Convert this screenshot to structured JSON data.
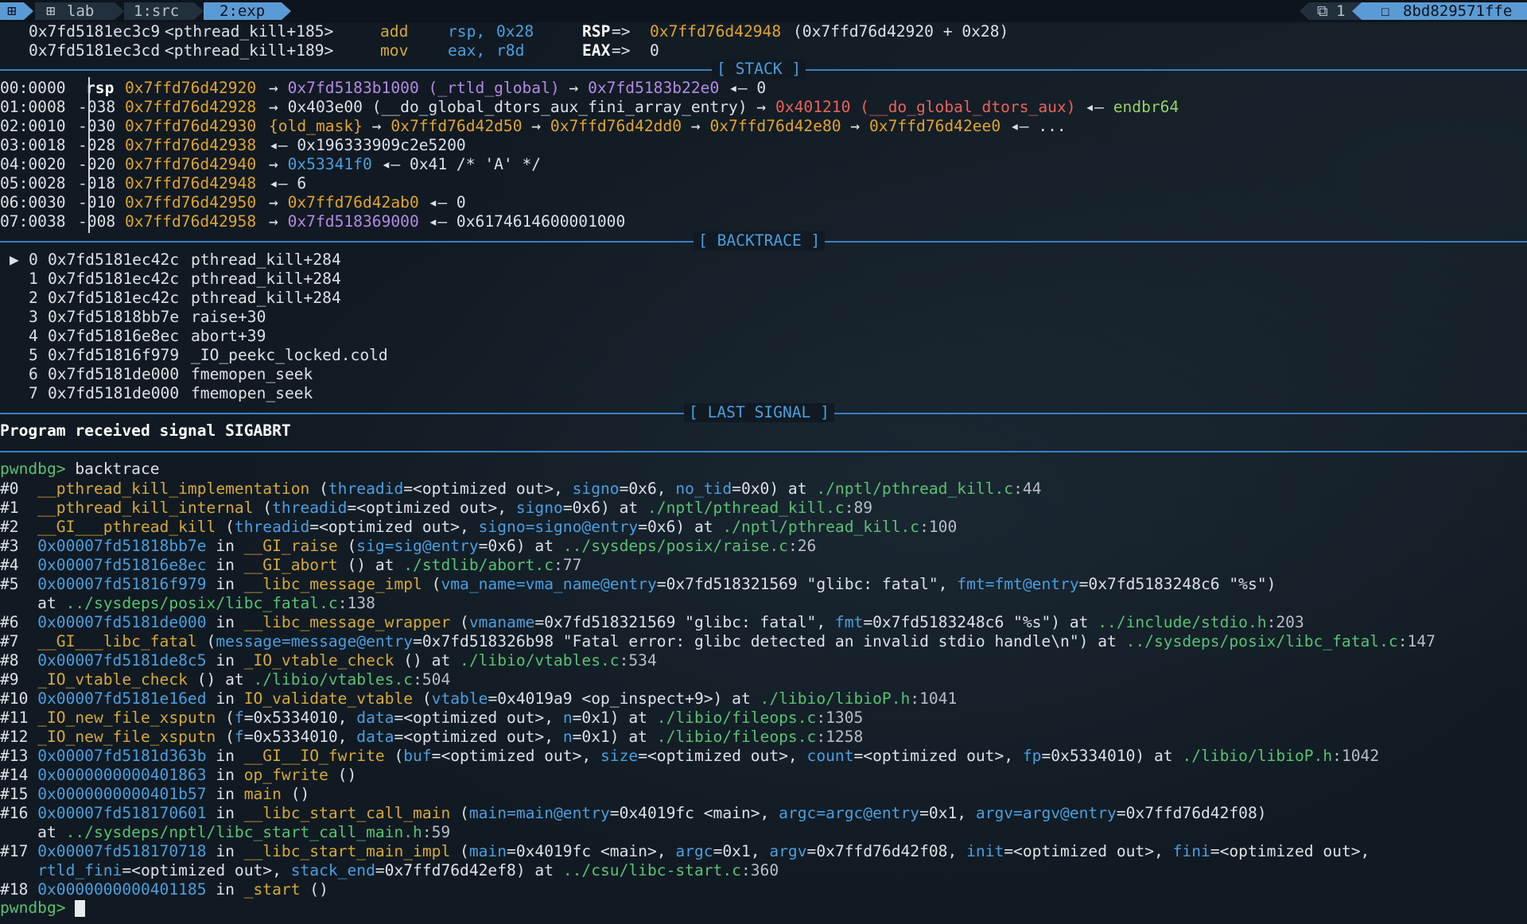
{
  "tmux": {
    "session_icon": "⊞",
    "window_icon": "⊞",
    "windows": [
      "lab",
      "1:src",
      "2:exp"
    ],
    "pane_icon": "⧉",
    "pane_count": "1",
    "host_icon": "☐",
    "host": "8bd829571ffe"
  },
  "disasm": [
    {
      "addr": "0x7fd5181ec3c9",
      "sym": "<pthread_kill+185>",
      "mn": "add",
      "op1": "rsp,",
      "op2": "0x28",
      "reg": "RSP",
      "arrow": "=>",
      "val": "0x7ffd76d42948",
      "extra": "(0x7ffd76d42920 + 0x28)"
    },
    {
      "addr": "0x7fd5181ec3cd",
      "sym": "<pthread_kill+189>",
      "mn": "mov",
      "op1": "eax,",
      "op2": "r8d",
      "reg": "EAX",
      "arrow": "=>",
      "val": "0",
      "extra": ""
    }
  ],
  "sections": {
    "stack": "[ STACK ]",
    "backtrace": "[ BACKTRACE ]",
    "last_signal": "[ LAST SIGNAL ]"
  },
  "stack": [
    {
      "idx": "00:0000",
      "reg": "rsp",
      "off": "",
      "addr": "0x7ffd76d42920",
      "rest": [
        [
          "→ ",
          "ar"
        ],
        [
          "0x7fd5183b1000 (_rtld_global)",
          "p"
        ],
        [
          " → ",
          "ar"
        ],
        [
          "0x7fd5183b22e0",
          "p"
        ],
        [
          " ◂— 0",
          "w"
        ]
      ]
    },
    {
      "idx": "01:0008",
      "reg": "",
      "off": "-038",
      "addr": "0x7ffd76d42928",
      "rest": [
        [
          "→ ",
          "ar"
        ],
        [
          "0x403e00 (__do_global_dtors_aux_fini_array_entry)",
          "w"
        ],
        [
          " → ",
          "ar"
        ],
        [
          "0x401210 (__do_global_dtors_aux)",
          "r"
        ],
        [
          " ◂— ",
          "w"
        ],
        [
          "endbr64",
          "lg"
        ]
      ]
    },
    {
      "idx": "02:0010",
      "reg": "",
      "off": "-030",
      "addr": "0x7ffd76d42930",
      "rest": [
        [
          "{old_mask}",
          "o"
        ],
        [
          " → ",
          "ar"
        ],
        [
          "0x7ffd76d42d50",
          "o"
        ],
        [
          " → ",
          "ar"
        ],
        [
          "0x7ffd76d42dd0",
          "o"
        ],
        [
          " → ",
          "ar"
        ],
        [
          "0x7ffd76d42e80",
          "o"
        ],
        [
          " → ",
          "ar"
        ],
        [
          "0x7ffd76d42ee0",
          "o"
        ],
        [
          " ◂— ...",
          "w"
        ]
      ]
    },
    {
      "idx": "03:0018",
      "reg": "",
      "off": "-028",
      "addr": "0x7ffd76d42938",
      "rest": [
        [
          "◂— 0x196333909c2e5200",
          "w"
        ]
      ]
    },
    {
      "idx": "04:0020",
      "reg": "",
      "off": "-020",
      "addr": "0x7ffd76d42940",
      "rest": [
        [
          "→ ",
          "ar"
        ],
        [
          "0x53341f0",
          "b"
        ],
        [
          " ◂— 0x41 /* 'A' */",
          "w"
        ]
      ]
    },
    {
      "idx": "05:0028",
      "reg": "",
      "off": "-018",
      "addr": "0x7ffd76d42948",
      "rest": [
        [
          "◂— 6",
          "w"
        ]
      ]
    },
    {
      "idx": "06:0030",
      "reg": "",
      "off": "-010",
      "addr": "0x7ffd76d42950",
      "rest": [
        [
          "→ ",
          "ar"
        ],
        [
          "0x7ffd76d42ab0",
          "o"
        ],
        [
          " ◂— 0",
          "w"
        ]
      ]
    },
    {
      "idx": "07:0038",
      "reg": "",
      "off": "-008",
      "addr": "0x7ffd76d42958",
      "rest": [
        [
          "→ ",
          "ar"
        ],
        [
          "0x7fd518369000",
          "p"
        ],
        [
          " ◂— 0x6174614600001000",
          "w"
        ]
      ]
    }
  ],
  "backtrace": [
    {
      "mark": "▶",
      "n": "0",
      "addr": "0x7fd5181ec42c",
      "sym": "pthread_kill+284"
    },
    {
      "mark": "",
      "n": "1",
      "addr": "0x7fd5181ec42c",
      "sym": "pthread_kill+284"
    },
    {
      "mark": "",
      "n": "2",
      "addr": "0x7fd5181ec42c",
      "sym": "pthread_kill+284"
    },
    {
      "mark": "",
      "n": "3",
      "addr": "0x7fd51818bb7e",
      "sym": "raise+30"
    },
    {
      "mark": "",
      "n": "4",
      "addr": "0x7fd51816e8ec",
      "sym": "abort+39"
    },
    {
      "mark": "",
      "n": "5",
      "addr": "0x7fd51816f979",
      "sym": "_IO_peekc_locked.cold"
    },
    {
      "mark": "",
      "n": "6",
      "addr": "0x7fd5181de000",
      "sym": "fmemopen_seek"
    },
    {
      "mark": "",
      "n": "7",
      "addr": "0x7fd5181de000",
      "sym": "fmemopen_seek"
    }
  ],
  "last_signal": "Program received signal SIGABRT",
  "prompt": "pwndbg>",
  "command": "backtrace",
  "gdb_bt": [
    [
      [
        "#0  ",
        "w"
      ],
      [
        "__pthread_kill_implementation",
        "y"
      ],
      [
        " (",
        "w"
      ],
      [
        "threadid",
        "b"
      ],
      [
        "=<optimized out>, ",
        "w"
      ],
      [
        "signo",
        "b"
      ],
      [
        "=0x6, ",
        "w"
      ],
      [
        "no_tid",
        "b"
      ],
      [
        "=0x0) at ",
        "w"
      ],
      [
        "./nptl/pthread_kill.c",
        "g"
      ],
      [
        ":44",
        "dim"
      ]
    ],
    [
      [
        "#1  ",
        "w"
      ],
      [
        "__pthread_kill_internal",
        "y"
      ],
      [
        " (",
        "w"
      ],
      [
        "threadid",
        "b"
      ],
      [
        "=<optimized out>, ",
        "w"
      ],
      [
        "signo",
        "b"
      ],
      [
        "=0x6) at ",
        "w"
      ],
      [
        "./nptl/pthread_kill.c",
        "g"
      ],
      [
        ":89",
        "dim"
      ]
    ],
    [
      [
        "#2  ",
        "w"
      ],
      [
        "__GI___pthread_kill",
        "y"
      ],
      [
        " (",
        "w"
      ],
      [
        "threadid",
        "b"
      ],
      [
        "=<optimized out>, ",
        "w"
      ],
      [
        "signo=signo@entry",
        "b"
      ],
      [
        "=0x6) at ",
        "w"
      ],
      [
        "./nptl/pthread_kill.c",
        "g"
      ],
      [
        ":100",
        "dim"
      ]
    ],
    [
      [
        "#3  ",
        "w"
      ],
      [
        "0x00007fd51818bb7e",
        "b"
      ],
      [
        " in ",
        "w"
      ],
      [
        "__GI_raise",
        "y"
      ],
      [
        " (",
        "w"
      ],
      [
        "sig=sig@entry",
        "b"
      ],
      [
        "=0x6) at ",
        "w"
      ],
      [
        "../sysdeps/posix/raise.c",
        "g"
      ],
      [
        ":26",
        "dim"
      ]
    ],
    [
      [
        "#4  ",
        "w"
      ],
      [
        "0x00007fd51816e8ec",
        "b"
      ],
      [
        " in ",
        "w"
      ],
      [
        "__GI_abort",
        "y"
      ],
      [
        " () at ",
        "w"
      ],
      [
        "./stdlib/abort.c",
        "g"
      ],
      [
        ":77",
        "dim"
      ]
    ],
    [
      [
        "#5  ",
        "w"
      ],
      [
        "0x00007fd51816f979",
        "b"
      ],
      [
        " in ",
        "w"
      ],
      [
        "__libc_message_impl",
        "y"
      ],
      [
        " (",
        "w"
      ],
      [
        "vma_name=vma_name@entry",
        "b"
      ],
      [
        "=0x7fd518321569 \"glibc: fatal\", ",
        "w"
      ],
      [
        "fmt=fmt@entry",
        "b"
      ],
      [
        "=0x7fd5183248c6 \"%s\")",
        "w"
      ]
    ],
    [
      [
        "    at ",
        "w"
      ],
      [
        "../sysdeps/posix/libc_fatal.c",
        "g"
      ],
      [
        ":138",
        "dim"
      ]
    ],
    [
      [
        "#6  ",
        "w"
      ],
      [
        "0x00007fd5181de000",
        "b"
      ],
      [
        " in ",
        "w"
      ],
      [
        "__libc_message_wrapper",
        "y"
      ],
      [
        " (",
        "w"
      ],
      [
        "vmaname",
        "b"
      ],
      [
        "=0x7fd518321569 \"glibc: fatal\", ",
        "w"
      ],
      [
        "fmt",
        "b"
      ],
      [
        "=0x7fd5183248c6 \"%s\") at ",
        "w"
      ],
      [
        "../include/stdio.h",
        "g"
      ],
      [
        ":203",
        "dim"
      ]
    ],
    [
      [
        "#7  ",
        "w"
      ],
      [
        "__GI___libc_fatal",
        "y"
      ],
      [
        " (",
        "w"
      ],
      [
        "message=message@entry",
        "b"
      ],
      [
        "=0x7fd518326b98 \"Fatal error: glibc detected an invalid stdio handle\\n\") at ",
        "w"
      ],
      [
        "../sysdeps/posix/libc_fatal.c",
        "g"
      ],
      [
        ":147",
        "dim"
      ]
    ],
    [
      [
        "#8  ",
        "w"
      ],
      [
        "0x00007fd5181de8c5",
        "b"
      ],
      [
        " in ",
        "w"
      ],
      [
        "_IO_vtable_check",
        "y"
      ],
      [
        " () at ",
        "w"
      ],
      [
        "./libio/vtables.c",
        "g"
      ],
      [
        ":534",
        "dim"
      ]
    ],
    [
      [
        "#9  ",
        "w"
      ],
      [
        "_IO_vtable_check",
        "y"
      ],
      [
        " () at ",
        "w"
      ],
      [
        "./libio/vtables.c",
        "g"
      ],
      [
        ":504",
        "dim"
      ]
    ],
    [
      [
        "#10 ",
        "w"
      ],
      [
        "0x00007fd5181e16ed",
        "b"
      ],
      [
        " in ",
        "w"
      ],
      [
        "IO_validate_vtable",
        "y"
      ],
      [
        " (",
        "w"
      ],
      [
        "vtable",
        "b"
      ],
      [
        "=0x4019a9 <op_inspect+9>) at ",
        "w"
      ],
      [
        "./libio/libioP.h",
        "g"
      ],
      [
        ":1041",
        "dim"
      ]
    ],
    [
      [
        "#11 ",
        "w"
      ],
      [
        "_IO_new_file_xsputn",
        "y"
      ],
      [
        " (",
        "w"
      ],
      [
        "f",
        "b"
      ],
      [
        "=0x5334010, ",
        "w"
      ],
      [
        "data",
        "b"
      ],
      [
        "=<optimized out>, ",
        "w"
      ],
      [
        "n",
        "b"
      ],
      [
        "=0x1) at ",
        "w"
      ],
      [
        "./libio/fileops.c",
        "g"
      ],
      [
        ":1305",
        "dim"
      ]
    ],
    [
      [
        "#12 ",
        "w"
      ],
      [
        "_IO_new_file_xsputn",
        "y"
      ],
      [
        " (",
        "w"
      ],
      [
        "f",
        "b"
      ],
      [
        "=0x5334010, ",
        "w"
      ],
      [
        "data",
        "b"
      ],
      [
        "=<optimized out>, ",
        "w"
      ],
      [
        "n",
        "b"
      ],
      [
        "=0x1) at ",
        "w"
      ],
      [
        "./libio/fileops.c",
        "g"
      ],
      [
        ":1258",
        "dim"
      ]
    ],
    [
      [
        "#13 ",
        "w"
      ],
      [
        "0x00007fd5181d363b",
        "b"
      ],
      [
        " in ",
        "w"
      ],
      [
        "__GI__IO_fwrite",
        "y"
      ],
      [
        " (",
        "w"
      ],
      [
        "buf",
        "b"
      ],
      [
        "=<optimized out>, ",
        "w"
      ],
      [
        "size",
        "b"
      ],
      [
        "=<optimized out>, ",
        "w"
      ],
      [
        "count",
        "b"
      ],
      [
        "=<optimized out>, ",
        "w"
      ],
      [
        "fp",
        "b"
      ],
      [
        "=0x5334010) at ",
        "w"
      ],
      [
        "./libio/libioP.h",
        "g"
      ],
      [
        ":1042",
        "dim"
      ]
    ],
    [
      [
        "#14 ",
        "w"
      ],
      [
        "0x0000000000401863",
        "b"
      ],
      [
        " in ",
        "w"
      ],
      [
        "op_fwrite",
        "y"
      ],
      [
        " ()",
        "w"
      ]
    ],
    [
      [
        "#15 ",
        "w"
      ],
      [
        "0x0000000000401b57",
        "b"
      ],
      [
        " in ",
        "w"
      ],
      [
        "main",
        "y"
      ],
      [
        " ()",
        "w"
      ]
    ],
    [
      [
        "#16 ",
        "w"
      ],
      [
        "0x00007fd518170601",
        "b"
      ],
      [
        " in ",
        "w"
      ],
      [
        "__libc_start_call_main",
        "y"
      ],
      [
        " (",
        "w"
      ],
      [
        "main=main@entry",
        "b"
      ],
      [
        "=0x4019fc <main>, ",
        "w"
      ],
      [
        "argc=argc@entry",
        "b"
      ],
      [
        "=0x1, ",
        "w"
      ],
      [
        "argv=argv@entry",
        "b"
      ],
      [
        "=0x7ffd76d42f08)",
        "w"
      ]
    ],
    [
      [
        "    at ",
        "w"
      ],
      [
        "../sysdeps/nptl/libc_start_call_main.h",
        "g"
      ],
      [
        ":59",
        "dim"
      ]
    ],
    [
      [
        "#17 ",
        "w"
      ],
      [
        "0x00007fd518170718",
        "b"
      ],
      [
        " in ",
        "w"
      ],
      [
        "__libc_start_main_impl",
        "y"
      ],
      [
        " (",
        "w"
      ],
      [
        "main",
        "b"
      ],
      [
        "=0x4019fc <main>, ",
        "w"
      ],
      [
        "argc",
        "b"
      ],
      [
        "=0x1, ",
        "w"
      ],
      [
        "argv",
        "b"
      ],
      [
        "=0x7ffd76d42f08, ",
        "w"
      ],
      [
        "init",
        "b"
      ],
      [
        "=<optimized out>, ",
        "w"
      ],
      [
        "fini",
        "b"
      ],
      [
        "=<optimized out>,",
        "w"
      ]
    ],
    [
      [
        "    ",
        "w"
      ],
      [
        "rtld_fini",
        "b"
      ],
      [
        "=<optimized out>, ",
        "w"
      ],
      [
        "stack_end",
        "b"
      ],
      [
        "=0x7ffd76d42ef8) at ",
        "w"
      ],
      [
        "../csu/libc-start.c",
        "g"
      ],
      [
        ":360",
        "dim"
      ]
    ],
    [
      [
        "#18 ",
        "w"
      ],
      [
        "0x0000000000401185",
        "b"
      ],
      [
        " in ",
        "w"
      ],
      [
        "_start",
        "y"
      ],
      [
        " ()",
        "w"
      ]
    ]
  ]
}
